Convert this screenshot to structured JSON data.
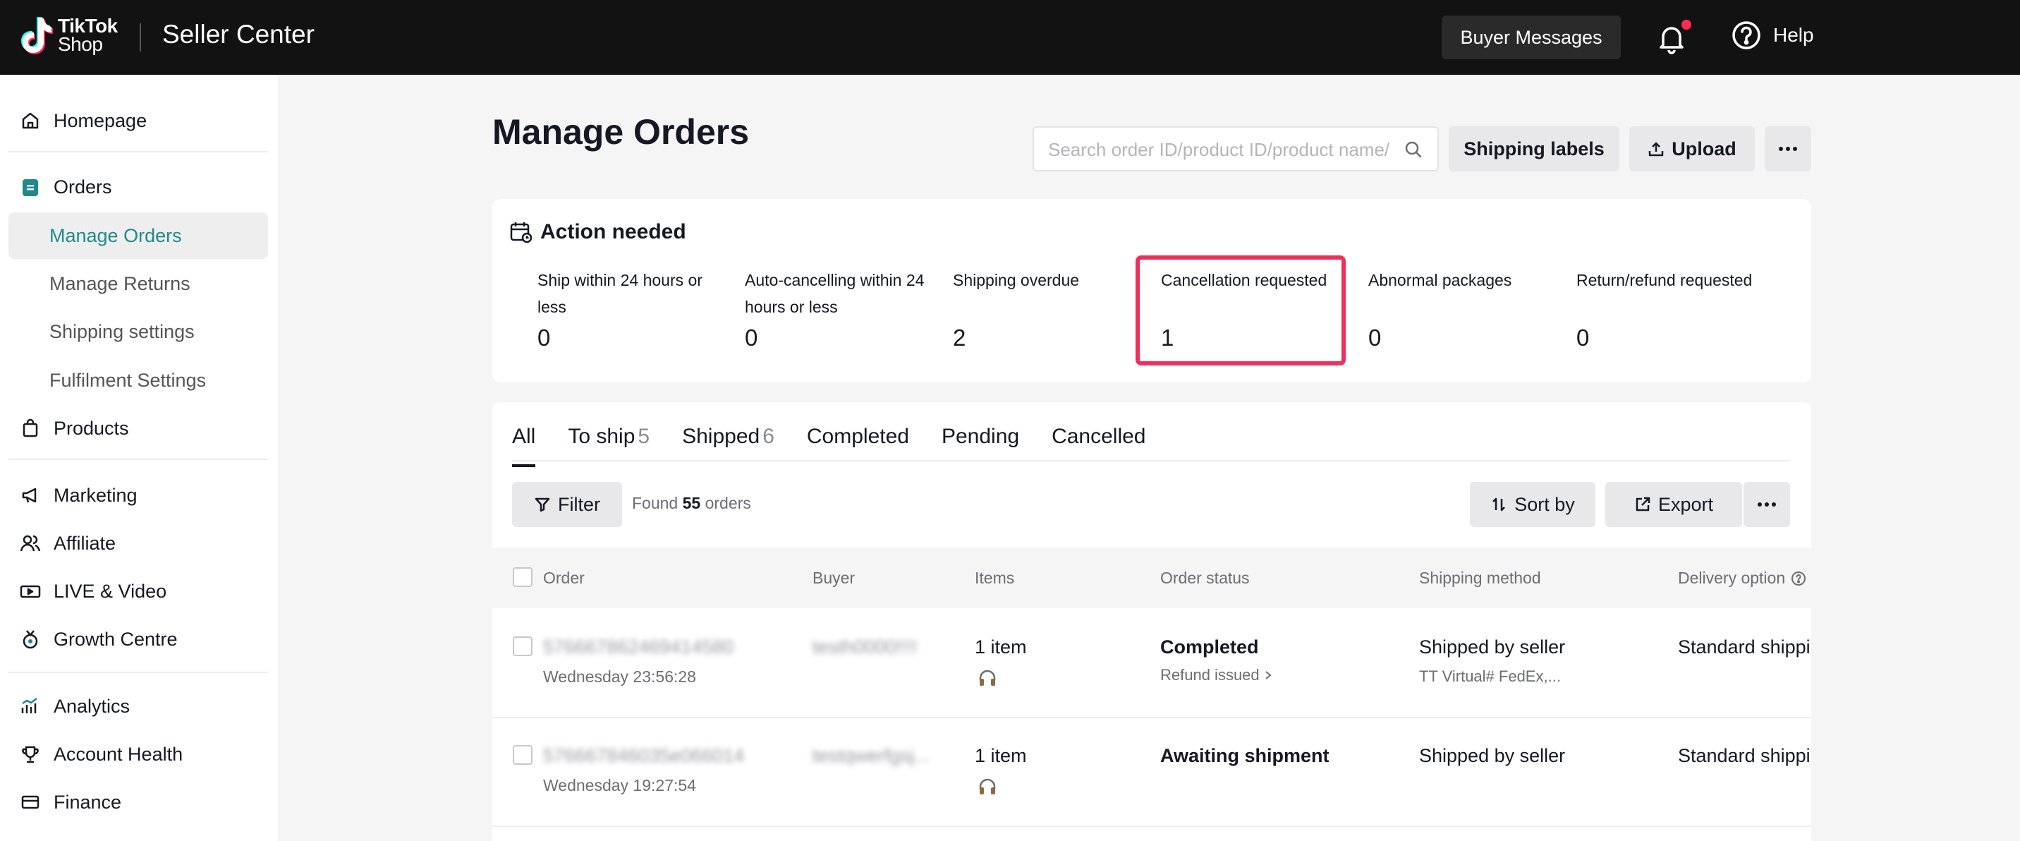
{
  "header": {
    "logo_line1": "TikTok",
    "logo_line2": "Shop",
    "title": "Seller Center",
    "buyer_messages": "Buyer Messages",
    "help": "Help",
    "notification_color": "#fe2c55"
  },
  "sidebar": {
    "items": [
      {
        "label": "Homepage",
        "icon": "home-icon"
      },
      {
        "label": "Orders",
        "icon": "orders-icon"
      },
      {
        "label": "Manage Orders",
        "active": true
      },
      {
        "label": "Manage Returns"
      },
      {
        "label": "Shipping settings"
      },
      {
        "label": "Fulfilment Settings"
      },
      {
        "label": "Products",
        "icon": "products-icon"
      },
      {
        "label": "Marketing",
        "icon": "megaphone-icon"
      },
      {
        "label": "Affiliate",
        "icon": "affiliate-icon"
      },
      {
        "label": "LIVE & Video",
        "icon": "video-icon"
      },
      {
        "label": "Growth Centre",
        "icon": "medal-icon"
      },
      {
        "label": "Analytics",
        "icon": "analytics-icon"
      },
      {
        "label": "Account Health",
        "icon": "trophy-icon"
      },
      {
        "label": "Finance",
        "icon": "finance-icon"
      }
    ],
    "active_color": "#1f8a8a"
  },
  "page": {
    "title": "Manage Orders",
    "search_placeholder": "Search order ID/product ID/product name/",
    "shipping_labels": "Shipping labels",
    "upload": "Upload"
  },
  "action_needed": {
    "title": "Action needed",
    "metrics": [
      {
        "label": "Ship within 24 hours or less",
        "value": "0"
      },
      {
        "label": "Auto-cancelling within 24 hours or less",
        "value": "0"
      },
      {
        "label": "Shipping overdue",
        "value": "2"
      },
      {
        "label": "Cancellation requested",
        "value": "1"
      },
      {
        "label": "Abnormal packages",
        "value": "0"
      },
      {
        "label": "Return/refund requested",
        "value": "0"
      }
    ],
    "highlight_color": "#f0305c"
  },
  "tabs": [
    {
      "label": "All",
      "count": ""
    },
    {
      "label": "To ship",
      "count": "5"
    },
    {
      "label": "Shipped",
      "count": "6"
    },
    {
      "label": "Completed",
      "count": ""
    },
    {
      "label": "Pending",
      "count": ""
    },
    {
      "label": "Cancelled",
      "count": ""
    }
  ],
  "toolbar": {
    "filter": "Filter",
    "found_prefix": "Found",
    "found_count": "55",
    "found_suffix": "orders",
    "sort_by": "Sort by",
    "export": "Export"
  },
  "table": {
    "columns": [
      "Order",
      "Buyer",
      "Items",
      "Order status",
      "Shipping method",
      "Delivery option"
    ],
    "rows": [
      {
        "order_id": "576667862469414580",
        "time": "Wednesday 23:56:28",
        "buyer": "testh0000!!!!",
        "items": "1 item",
        "status": "Completed",
        "status_sub": "Refund issued",
        "shipping": "Shipped by seller",
        "shipping_sub": "TT Virtual# FedEx,...",
        "delivery": "Standard shippi"
      },
      {
        "order_id": "576667846035e066014",
        "time": "Wednesday 19:27:54",
        "buyer": "testqwerfgsj...",
        "items": "1 item",
        "status": "Awaiting shipment",
        "status_sub": "",
        "shipping": "Shipped by seller",
        "shipping_sub": "",
        "delivery": "Standard shippi"
      }
    ]
  }
}
